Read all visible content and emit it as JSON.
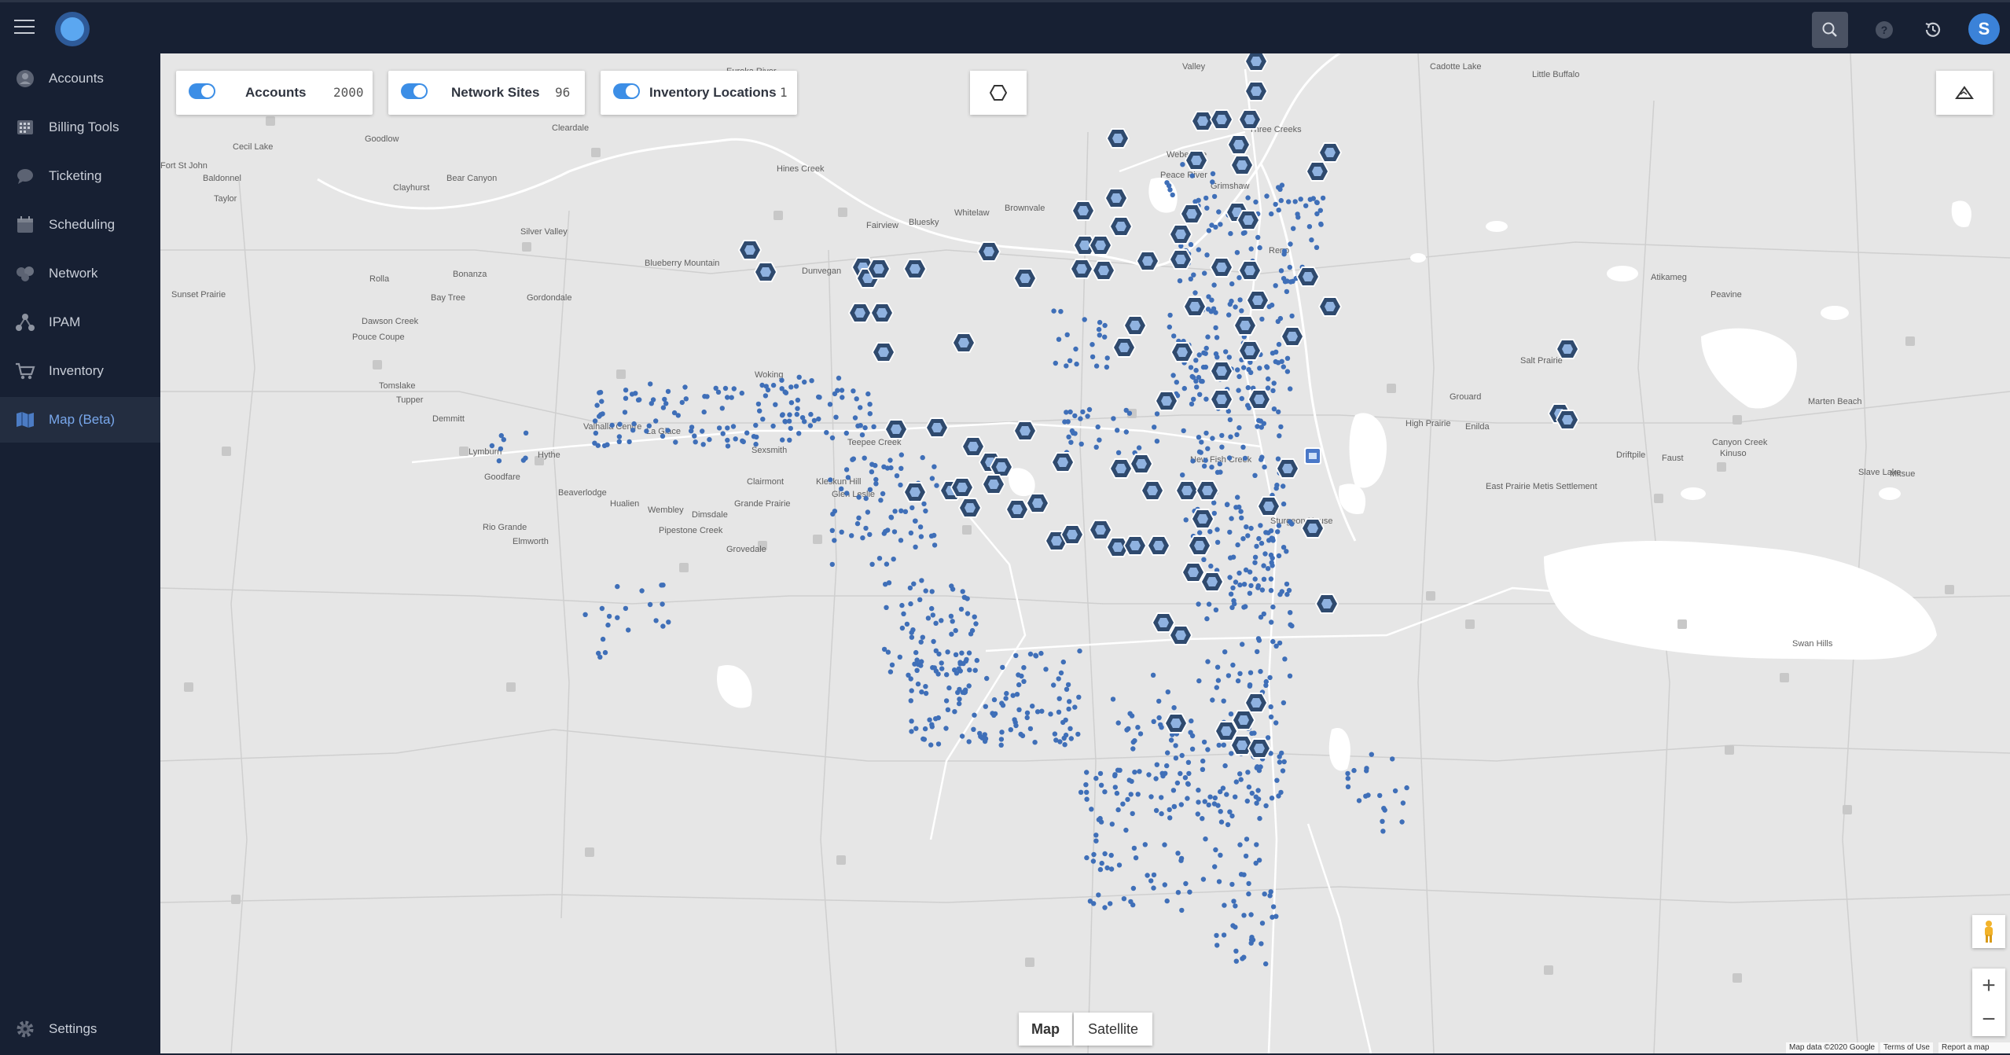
{
  "topbar": {
    "icons": [
      "menu-icon",
      "logo",
      "search-icon",
      "help-icon",
      "history-icon"
    ],
    "avatar_initial": "S"
  },
  "sidebar": {
    "items": [
      {
        "label": "Accounts",
        "icon": "user-icon"
      },
      {
        "label": "Billing Tools",
        "icon": "calculator-icon"
      },
      {
        "label": "Ticketing",
        "icon": "chat-bubble-icon"
      },
      {
        "label": "Scheduling",
        "icon": "calendar-icon"
      },
      {
        "label": "Network",
        "icon": "network-icon"
      },
      {
        "label": "IPAM",
        "icon": "ipam-tree-icon"
      },
      {
        "label": "Inventory",
        "icon": "cart-icon"
      },
      {
        "label": "Map (Beta)",
        "icon": "map-icon",
        "active": true
      }
    ],
    "settings_label": "Settings"
  },
  "map": {
    "layers": [
      {
        "label": "Accounts",
        "count": "2000",
        "enabled": true
      },
      {
        "label": "Network Sites",
        "count": "96",
        "enabled": true
      },
      {
        "label": "Inventory Locations",
        "count": "1",
        "enabled": true
      }
    ],
    "map_type": {
      "map_label": "Map",
      "satellite_label": "Satellite",
      "selected": "Map"
    },
    "zoom_in": "+",
    "zoom_out": "−",
    "attribution": {
      "data": "Map data ©2020 Google",
      "terms": "Terms of Use",
      "report": "Report a map error"
    },
    "towns": [
      "Valley",
      "Cadotte Lake",
      "Little Buffalo",
      "Eureka River",
      "Three Creeks",
      "Goodlow",
      "Cleardale",
      "Cecil Lake",
      "Weberville",
      "Fort St John",
      "Baldonnel",
      "Hines Creek",
      "Peace River",
      "Bear Canyon",
      "Clayhurst",
      "Grimshaw",
      "Taylor",
      "Brownvale",
      "Whitelaw",
      "Fairview",
      "Bluesky",
      "Silver Valley",
      "Reno",
      "Blueberry Mountain",
      "Rolla",
      "Bonanza",
      "Dunvegan",
      "Atikameg",
      "Sunset Prairie",
      "Bay Tree",
      "Gordondale",
      "Peavine",
      "Dawson Creek",
      "Pouce Coupe",
      "Salt Prairie",
      "Tomslake",
      "Woking",
      "Tupper",
      "Grouard",
      "Marten Beach",
      "Demmitt",
      "Valhalla Centre",
      "La Glace",
      "High Prairie",
      "Enilda",
      "Teepee Creek",
      "Lymburn",
      "Hythe",
      "Sexsmith",
      "Canyon Creek",
      "Driftpile",
      "Faust",
      "Kinuso",
      "Slave Lake",
      "Mitsue",
      "Goodfare",
      "Clairmont",
      "Kleskun Hill",
      "New Fish Creek",
      "Beaverlodge",
      "Glen Leslie",
      "East Prairie Metis Settlement",
      "Hualien",
      "Wembley",
      "Dimsdale",
      "Grande Prairie",
      "Sturgeon House",
      "Rio Grande",
      "Elmworth",
      "Pipestone Creek",
      "Grovedale",
      "Swan Hills"
    ]
  }
}
